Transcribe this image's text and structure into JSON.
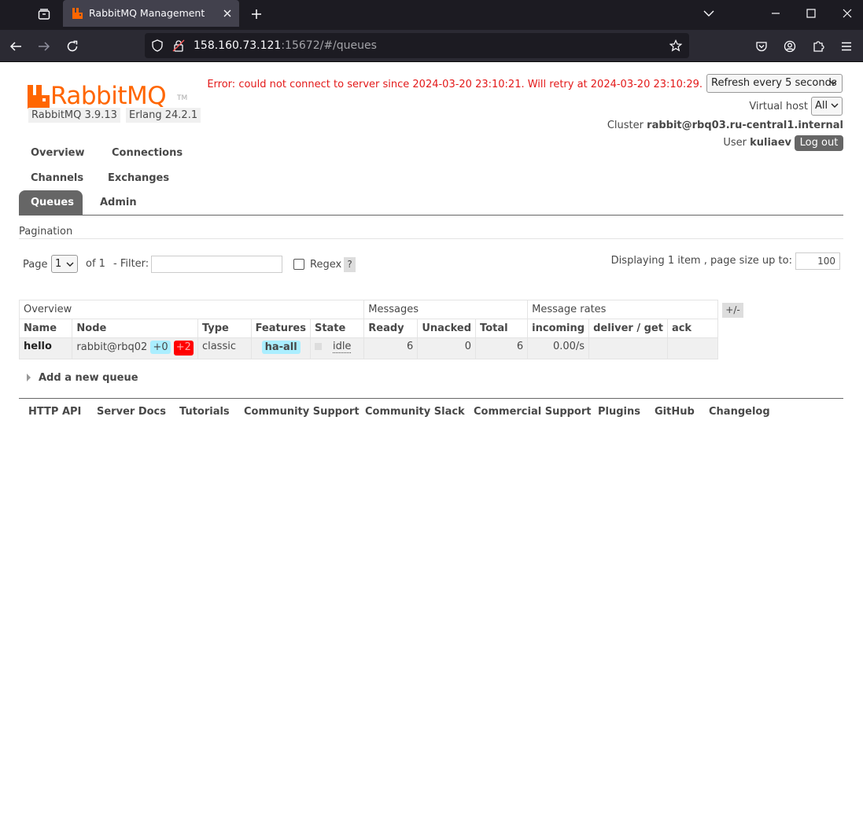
{
  "browser": {
    "tab_title": "RabbitMQ Management",
    "url_host": "158.160.73.121",
    "url_rest": ":15672/#/queues"
  },
  "header": {
    "logo_text": "RabbitMQ",
    "logo_tm": "TM",
    "rabbitmq_version": "RabbitMQ 3.9.13",
    "erlang_version": "Erlang 24.2.1",
    "error_message": "Error: could not connect to server since 2024-03-20 23:10:21. Will retry at 2024-03-20 23:10:29.",
    "refresh_selected": "Refresh every 5 seconds",
    "vhost_label": "Virtual host",
    "vhost_selected": "All",
    "cluster_label": "Cluster",
    "cluster_name": "rabbit@rbq03.ru-central1.internal",
    "user_label": "User",
    "user_name": "kuliaev",
    "logout_label": "Log out"
  },
  "menu": {
    "overview": "Overview",
    "connections": "Connections",
    "channels": "Channels",
    "exchanges": "Exchanges",
    "queues": "Queues",
    "admin": "Admin"
  },
  "pagination": {
    "title": "Pagination",
    "page_label": "Page",
    "page_selected": "1",
    "of_label": "of 1",
    "filter_label": "- Filter:",
    "filter_value": "",
    "regex_label": "Regex",
    "help": "?",
    "displaying": "Displaying 1 item , page size up to:",
    "page_size": "100"
  },
  "table": {
    "groups": {
      "overview": "Overview",
      "messages": "Messages",
      "rates": "Message rates"
    },
    "columns": {
      "name": "Name",
      "node": "Node",
      "type": "Type",
      "features": "Features",
      "state": "State",
      "ready": "Ready",
      "unacked": "Unacked",
      "total": "Total",
      "incoming": "incoming",
      "deliver_get": "deliver / get",
      "ack": "ack"
    },
    "toggle": "+/-",
    "rows": [
      {
        "name": "hello",
        "node": "rabbit@rbq02",
        "sync_badge": "+0",
        "unsync_badge": "+2",
        "type": "classic",
        "features": "ha-all",
        "state": "idle",
        "ready": "6",
        "unacked": "0",
        "total": "6",
        "incoming": "0.00/s",
        "deliver_get": "",
        "ack": ""
      }
    ]
  },
  "add_queue": "Add a new queue",
  "footer": {
    "links": [
      "HTTP API",
      "Server Docs",
      "Tutorials",
      "Community Support",
      "Community Slack",
      "Commercial Support",
      "Plugins",
      "GitHub",
      "Changelog"
    ]
  },
  "colors": {
    "logo_orange": "#ff6600",
    "error_red": "#e31919",
    "active_tab": "#666666",
    "badge_blue": "#aaeeff",
    "badge_red": "#ff0000"
  }
}
